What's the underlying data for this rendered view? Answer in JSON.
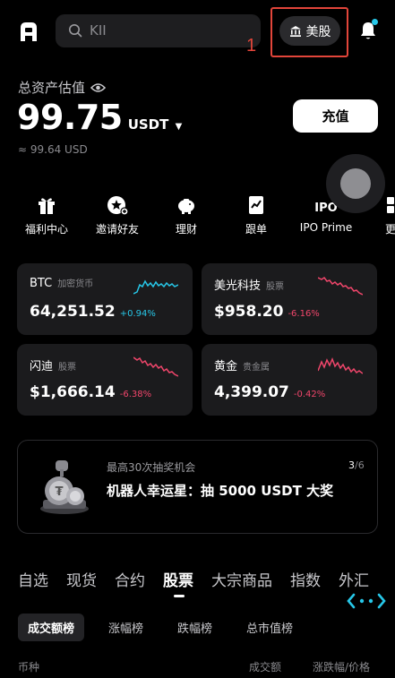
{
  "header": {
    "search_placeholder": "KII",
    "market_button_label": "美股",
    "annotation_number": "1"
  },
  "assets": {
    "label": "总资产估值",
    "balance": "99.75",
    "unit": "USDT",
    "usd_equivalent": "≈ 99.64 USD",
    "deposit_label": "充值"
  },
  "shortcuts": [
    {
      "label": "福利中心",
      "icon": "gift-icon"
    },
    {
      "label": "邀请好友",
      "icon": "invite-icon"
    },
    {
      "label": "理财",
      "icon": "piggy-bank-icon"
    },
    {
      "label": "跟单",
      "icon": "copy-trade-icon"
    },
    {
      "label": "IPO Prime",
      "icon": "ipo-icon"
    },
    {
      "label": "更",
      "icon": "more-icon"
    }
  ],
  "market_cards": [
    {
      "name": "BTC",
      "tag": "加密货币",
      "price": "64,251.52",
      "change": "+0.94%",
      "trend": "up",
      "color": "#27c7e8"
    },
    {
      "name": "美光科技",
      "tag": "股票",
      "price": "$958.20",
      "change": "-6.16%",
      "trend": "down",
      "color": "#f0466b"
    },
    {
      "name": "闪迪",
      "tag": "股票",
      "price": "$1,666.14",
      "change": "-6.38%",
      "trend": "down",
      "color": "#f0466b"
    },
    {
      "name": "黄金",
      "tag": "贵金属",
      "price": "4,399.07",
      "change": "-0.42%",
      "trend": "down",
      "color": "#f0466b"
    }
  ],
  "promo": {
    "subtitle": "最高30次抽奖机会",
    "title": "机器人幸运星：抽 5000 USDT 大奖",
    "page_current": "3",
    "page_total": "/6"
  },
  "category_tabs": [
    "自选",
    "现货",
    "合约",
    "股票",
    "大宗商品",
    "指数",
    "外汇"
  ],
  "category_active": 3,
  "sub_tabs": [
    "成交额榜",
    "涨幅榜",
    "跌幅榜",
    "总市值榜"
  ],
  "sub_tab_active": 0,
  "list_header": {
    "col_name": "币种",
    "col_volume": "成交额",
    "col_change": "涨跌幅/价格"
  },
  "colors": {
    "accent_cyan": "#27c7e8",
    "down_red": "#f0466b",
    "annotation_red": "#e2453a"
  }
}
